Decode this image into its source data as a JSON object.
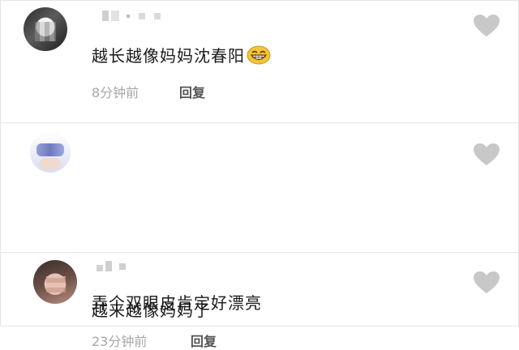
{
  "comments": [
    {
      "text": "越长越像妈妈沈春阳",
      "emoji": "grinning-face",
      "time": "8分钟前",
      "reply_label": "回复"
    },
    {
      "text": "弄个双眼皮肯定好漂亮",
      "time": "23分钟前",
      "reply_label": "回复"
    },
    {
      "text": "越来越像妈妈了"
    }
  ],
  "colors": {
    "text": "#1a1a1a",
    "meta": "#a8a8a8",
    "reply": "#555555",
    "heart": "#c8c8c8",
    "emoji": "#f5c437"
  },
  "icons": [
    "avatar",
    "like-heart-icon",
    "grinning-emoji-icon"
  ]
}
